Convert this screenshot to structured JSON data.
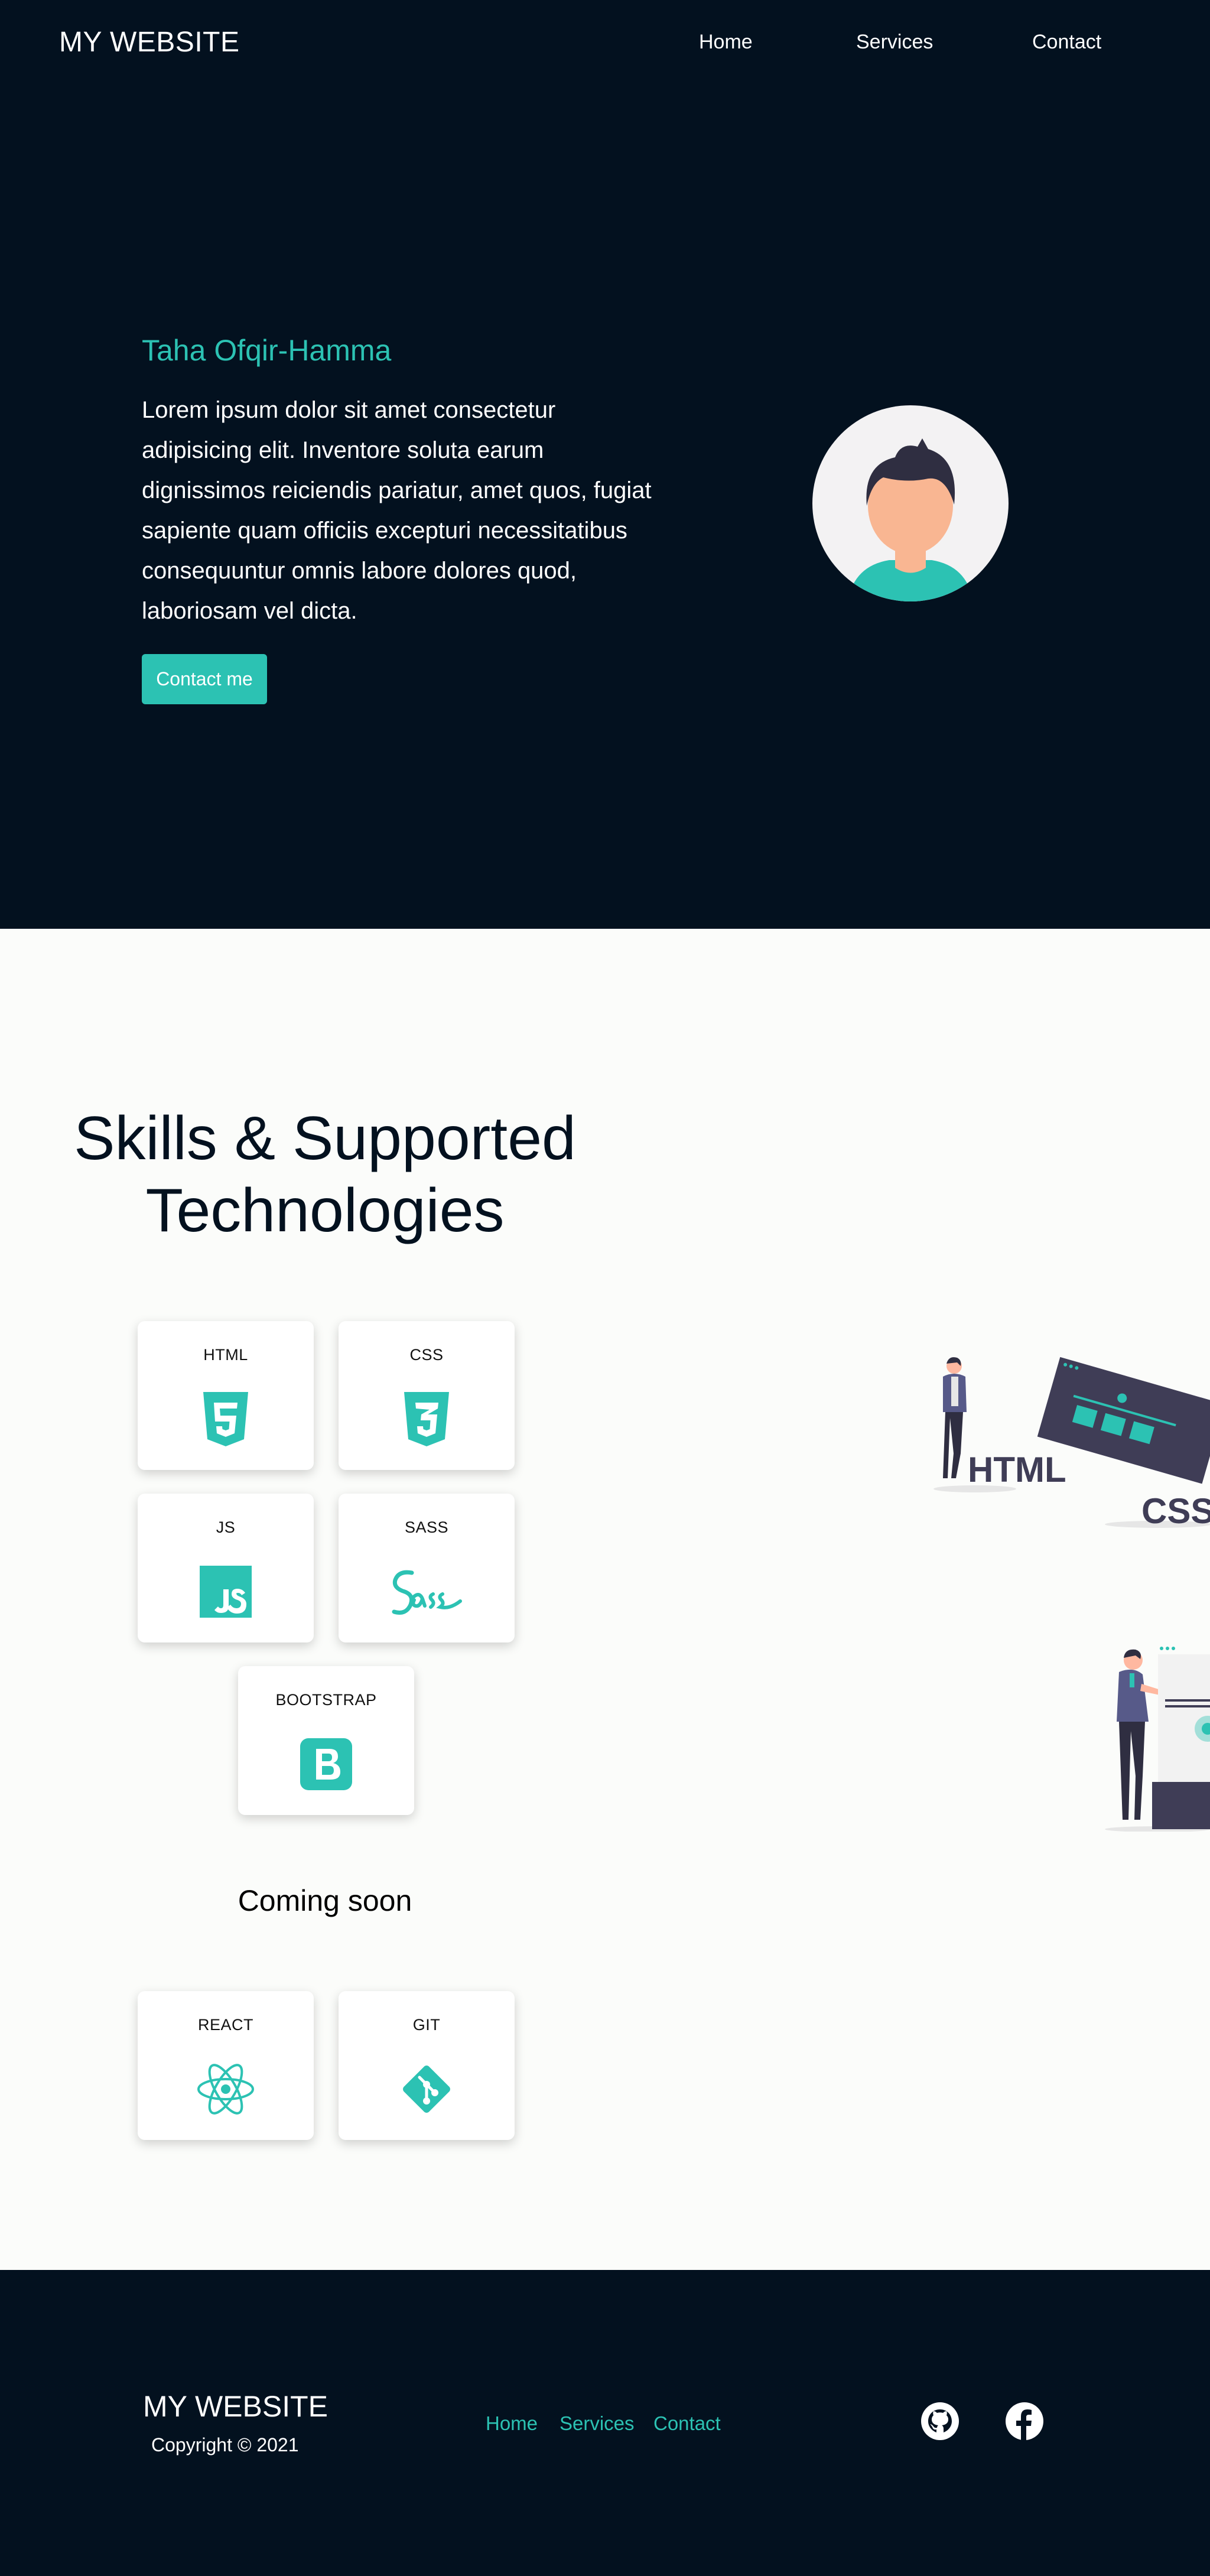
{
  "header": {
    "logo": "MY WEBSITE",
    "nav": [
      "Home",
      "Services",
      "Contact"
    ]
  },
  "hero": {
    "name": "Taha Ofqir-Hamma",
    "text": "Lorem ipsum dolor sit amet consectetur adipisicing elit. Inventore soluta earum dignissimos reiciendis pariatur, amet quos, fugiat sapiente quam officiis excepturi necessitatibus consequuntur omnis labore dolores quod, laboriosam vel dicta.",
    "button": "Contact me",
    "avatar_icon": "user-avatar-icon"
  },
  "skills": {
    "title_line1": "Skills & Supported",
    "title_line2": "Technologies",
    "cards": [
      {
        "label": "HTML",
        "icon": "html5-icon"
      },
      {
        "label": "CSS",
        "icon": "css3-icon"
      },
      {
        "label": "JS",
        "icon": "javascript-icon"
      },
      {
        "label": "SASS",
        "icon": "sass-icon"
      },
      {
        "label": "BOOTSTRAP",
        "icon": "bootstrap-icon"
      }
    ],
    "coming_soon": "Coming soon",
    "upcoming": [
      {
        "label": "REACT",
        "icon": "react-icon"
      },
      {
        "label": "GIT",
        "icon": "git-icon"
      }
    ],
    "illustration_text_1": "HTML",
    "illustration_text_2": "CSS"
  },
  "footer": {
    "logo": "MY WEBSITE",
    "copyright": "Copyright © 2021",
    "links": [
      "Home",
      "Services",
      "Contact"
    ],
    "social": [
      "github-icon",
      "facebook-icon"
    ]
  },
  "colors": {
    "dark": "#03111f",
    "accent": "#2cc2b3",
    "light_bg": "#fbfcfa"
  }
}
